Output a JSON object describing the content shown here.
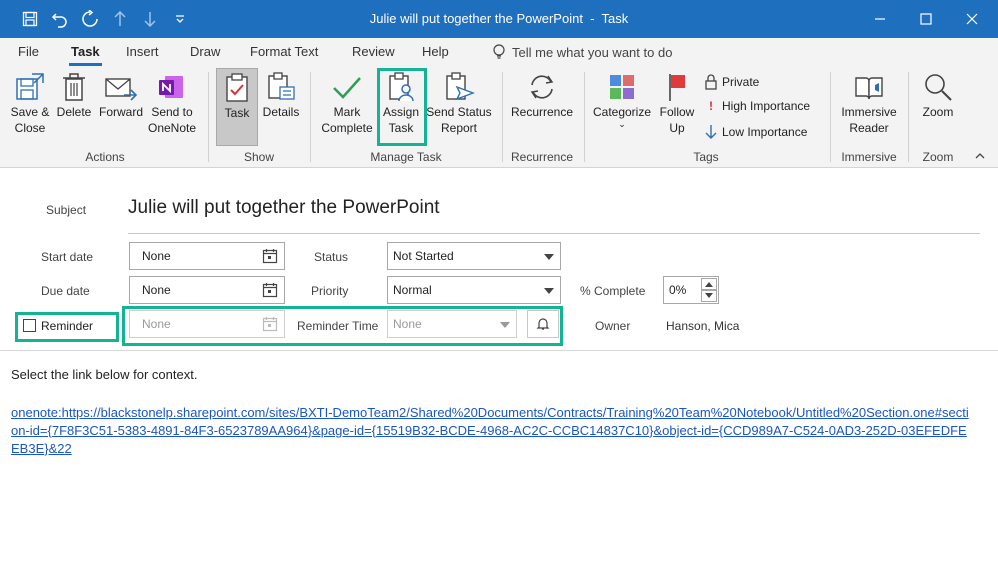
{
  "window": {
    "title": "Julie will put together the PowerPoint  -  Task"
  },
  "menu": {
    "tabs": [
      "File",
      "Task",
      "Insert",
      "Draw",
      "Format Text",
      "Review",
      "Help"
    ],
    "tell_me": "Tell me what you want to do"
  },
  "ribbon": {
    "actions": {
      "save_close": "Save &\nClose",
      "delete": "Delete",
      "forward": "Forward",
      "onenote": "Send to\nOneNote",
      "label": "Actions"
    },
    "show": {
      "task": "Task",
      "details": "Details",
      "label": "Show"
    },
    "manage": {
      "mark_complete": "Mark\nComplete",
      "assign_task": "Assign\nTask",
      "send_status": "Send Status\nReport",
      "label": "Manage Task"
    },
    "recurrence": {
      "recurrence": "Recurrence",
      "label": "Recurrence"
    },
    "tags": {
      "categorize": "Categorize",
      "follow_up": "Follow\nUp",
      "private": "Private",
      "high": "High Importance",
      "low": "Low Importance",
      "label": "Tags"
    },
    "immersive": {
      "reader": "Immersive\nReader",
      "label": "Immersive"
    },
    "zoom": {
      "zoom": "Zoom",
      "label": "Zoom"
    }
  },
  "form": {
    "subject_label": "Subject",
    "subject": "Julie will put together the PowerPoint",
    "start_date_label": "Start date",
    "start_date": "None",
    "due_date_label": "Due date",
    "due_date": "None",
    "status_label": "Status",
    "status": "Not Started",
    "priority_label": "Priority",
    "priority": "Normal",
    "complete_label": "% Complete",
    "complete": "0%",
    "reminder_label": "Reminder",
    "reminder_date": "None",
    "reminder_time_label": "Reminder Time",
    "reminder_time": "None",
    "owner_label": "Owner",
    "owner": "Hanson, Mica"
  },
  "body": {
    "intro": "Select the link below for context.",
    "link": "onenote:https://blackstonelp.sharepoint.com/sites/BXTI-DemoTeam2/Shared%20Documents/Contracts/Training%20Team%20Notebook/Untitled%20Section.one#section-id={7F8F3C51-5383-4891-84F3-6523789AA964}&page-id={15519B32-BCDE-4968-AC2C-CCBC14837C10}&object-id={CCD989A7-C524-0AD3-252D-03EFEDFEEB3E}&22"
  },
  "colors": {
    "titlebar": "#1f6fbf",
    "highlight": "#13b394",
    "link": "#1a56c5"
  }
}
